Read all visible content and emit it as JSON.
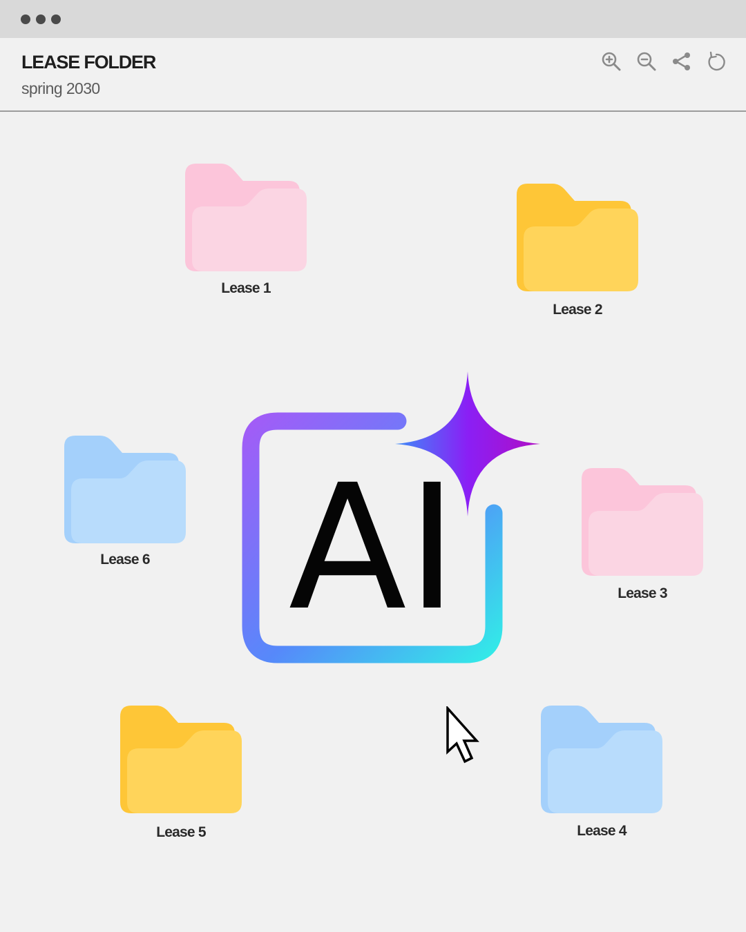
{
  "window": {
    "controls": [
      "dot",
      "dot",
      "dot"
    ]
  },
  "header": {
    "title": "LEASE FOLDER",
    "subtitle": "spring 2030",
    "tools": [
      "zoom-in-icon",
      "zoom-out-icon",
      "share-icon",
      "refresh-icon"
    ]
  },
  "colors": {
    "pink": "#fbd5e3",
    "pink_tab": "#fcc5da",
    "yellow": "#ffd45a",
    "yellow_tab": "#fec637",
    "blue": "#b8dcfc",
    "blue_tab": "#a4d0fb",
    "gradient_start": "#a25cf7",
    "gradient_mid": "#5689fa",
    "gradient_end": "#33eae8"
  },
  "folders": [
    {
      "label": "Lease 1",
      "color": "pink"
    },
    {
      "label": "Lease 2",
      "color": "yellow"
    },
    {
      "label": "Lease 3",
      "color": "pink"
    },
    {
      "label": "Lease 4",
      "color": "blue"
    },
    {
      "label": "Lease 5",
      "color": "yellow"
    },
    {
      "label": "Lease 6",
      "color": "blue"
    }
  ],
  "center_logo": {
    "text": "AI",
    "icon": "sparkle-icon"
  },
  "pointer": {
    "icon": "mouse-cursor-icon"
  }
}
